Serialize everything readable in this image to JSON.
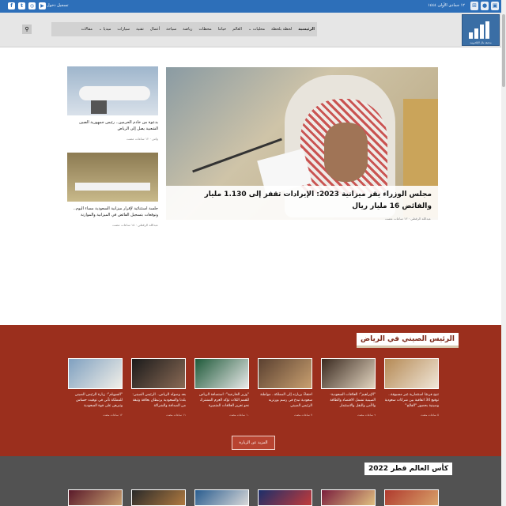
{
  "topbar": {
    "date": "١٢ جمادى الأولى ١٤٤٤",
    "login": "تسجيل دخول",
    "social_icons": [
      "facebook-icon",
      "twitter-icon",
      "instagram-icon",
      "youtube-icon"
    ],
    "app_icons": [
      "android-icon",
      "apple-icon",
      "windows-icon"
    ]
  },
  "header": {
    "logo_text": "صحيفة مال الإلكترونية",
    "nav_items": [
      "الرئيسية",
      "لحظة بلحظة",
      "محليات ⌄",
      "العالم",
      "حياتنا",
      "محطات",
      "رياضة",
      "سياحة",
      "أعمال",
      "تقنية",
      "سيارات",
      "ميديا ⌄",
      "مقالات"
    ]
  },
  "hero": {
    "title": "مجلس الوزراء يقر ميزانية 2023: الإيرادات تقفز إلى 1.130 مليار والفائض 16 مليار ريال",
    "author": "عبدالله الرقطي",
    "time": "١٣ ساعات مضت"
  },
  "side_cards": [
    {
      "title": "بدعوة من خادم الحرمين.. رئيس جمهورية الصين الشعبية يصل إلى الرياض",
      "author": "واس",
      "time": "١٢ ساعات مضت"
    },
    {
      "title": "جلسة استثنائية لإقرار ميزانية السعودية مساء اليوم.. وتوقعات بتسجيل الفائض في الميزانية والموازنة",
      "author": "عبدالله الرقطي",
      "time": "١٥ ساعات مضت"
    }
  ],
  "red_section": {
    "title": "الرئيس الصيني في الرياض",
    "cards": [
      {
        "title": "تتيح فرصًا استثمارية غير مسبوقة.. توقيع 34 اتفاقية بين شركات سعودية وصينية بحضور \"الفالح\"",
        "time": "٥ ساعات مضت"
      },
      {
        "title": "\"الإبراهيم\": العلاقات السعودية-الصينية تشمل الاقتصاد والطاقة والأمن والنقل والاستثمار",
        "time": "٦ ساعات مضت"
      },
      {
        "title": "احتفاءً بزيارته إلى المملكة.. مواطنة سعودية تبدع في رسم بورتريه الرئيس الصيني",
        "time": "٧ ساعات مضت"
      },
      {
        "title": "\"وزير الخارجية\": استضافة الرياض للقمم الثلاث تؤكد العزم المشترك نحو تعزيز العلاقات المتميزة",
        "time": "١٠ ساعات مضت"
      },
      {
        "title": "بعد وصوله الرياض.. الرئيس الصيني: بلدنا والسعودية يرتبطان بعلاقة وثيقة من الصداقة والشراكة",
        "time": "١١ ساعات مضت"
      },
      {
        "title": "\"السويلم\": زيارة الرئيس الصيني للمملكة تأتي في توقيت حساس وتبرهن على قوة السعودية",
        "time": "١٢ ساعات مضت"
      }
    ],
    "more_label": "المزيد عن الزيارة"
  },
  "gray_section": {
    "title": "كأس العالم قطر 2022"
  }
}
